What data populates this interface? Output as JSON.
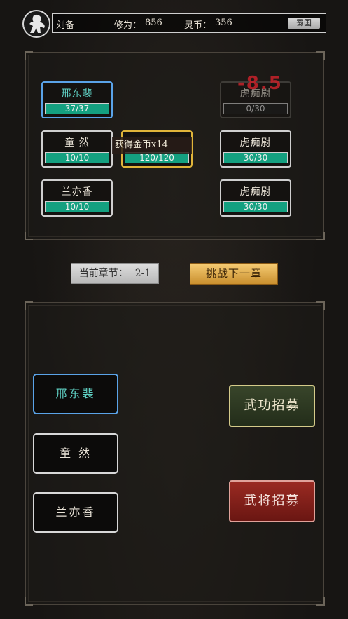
{
  "header": {
    "player_name": "刘备",
    "cultivation_label": "修为：",
    "cultivation_value": "856",
    "coins_label": "灵币：",
    "coins_value": "356",
    "kingdom_button": "蜀国"
  },
  "battle": {
    "allies": [
      {
        "name": "邢东裴",
        "hp": "37/37",
        "hp_fraction": 1.0,
        "state": "selected"
      },
      {
        "name": "童 然",
        "hp": "10/10",
        "hp_fraction": 1.0,
        "state": "normal"
      },
      {
        "name": "兰亦香",
        "hp": "10/10",
        "hp_fraction": 1.0,
        "state": "normal"
      }
    ],
    "center_unit": {
      "hp": "120/120",
      "hp_fraction": 1.0,
      "state": "active"
    },
    "enemies": [
      {
        "name": "虎痴尉",
        "hp": "0/30",
        "hp_fraction": 0.0,
        "state": "defeated"
      },
      {
        "name": "虎痴尉",
        "hp": "30/30",
        "hp_fraction": 1.0,
        "state": "normal"
      },
      {
        "name": "虎痴尉",
        "hp": "30/30",
        "hp_fraction": 1.0,
        "state": "normal"
      }
    ],
    "damage_popup": "-8.5",
    "reward_popup": "获得金币x14"
  },
  "chapter": {
    "label": "当前章节：",
    "value": "2-1",
    "next_button": "挑战下一章"
  },
  "roster": [
    {
      "name": "邢东裴",
      "selected": true
    },
    {
      "name": "童 然",
      "selected": false
    },
    {
      "name": "兰亦香",
      "selected": false
    }
  ],
  "recruit": {
    "skill_button": "武功招募",
    "general_button": "武将招募"
  },
  "colors": {
    "hp_fill": "#14a080",
    "selected_border": "#5aa3e8",
    "active_border": "#e0b43a",
    "damage_text": "#c8222a",
    "next_button": "#e4ae50"
  }
}
